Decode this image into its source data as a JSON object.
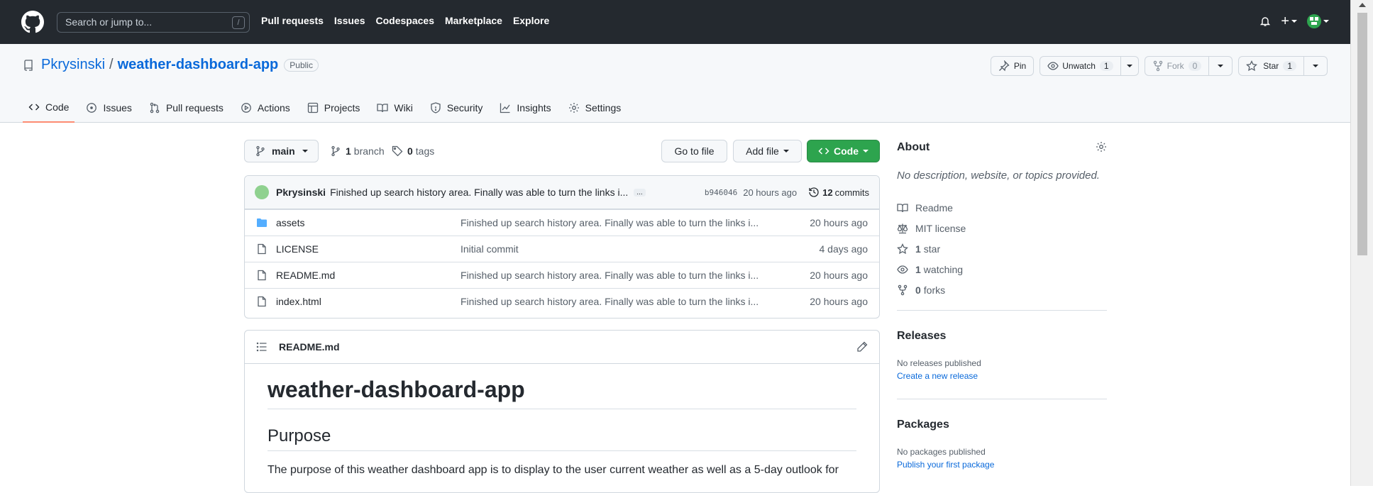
{
  "header": {
    "search_placeholder": "Search or jump to...",
    "search_shortcut": "/",
    "nav": [
      "Pull requests",
      "Issues",
      "Codespaces",
      "Marketplace",
      "Explore"
    ],
    "plus_label": "+"
  },
  "repo": {
    "owner": "Pkrysinski",
    "separator": "/",
    "name": "weather-dashboard-app",
    "visibility": "Public",
    "pin_label": "Pin",
    "unwatch_label": "Unwatch",
    "unwatch_count": "1",
    "fork_label": "Fork",
    "fork_count": "0",
    "star_label": "Star",
    "star_count": "1"
  },
  "tabs": [
    "Code",
    "Issues",
    "Pull requests",
    "Actions",
    "Projects",
    "Wiki",
    "Security",
    "Insights",
    "Settings"
  ],
  "toolbar": {
    "branch": "main",
    "branches_count": "1",
    "branches_label": "branch",
    "tags_count": "0",
    "tags_label": "tags",
    "go_to_file": "Go to file",
    "add_file": "Add file",
    "code": "Code"
  },
  "commit": {
    "author": "Pkrysinski",
    "message": "Finished up search history area. Finally was able to turn the links i...",
    "ellipsis": "...",
    "sha": "b946046",
    "age": "20 hours ago",
    "commits_count": "12",
    "commits_label": "commits"
  },
  "files": [
    {
      "name": "assets",
      "type": "folder",
      "message": "Finished up search history area. Finally was able to turn the links i...",
      "age": "20 hours ago"
    },
    {
      "name": "LICENSE",
      "type": "file",
      "message": "Initial commit",
      "age": "4 days ago"
    },
    {
      "name": "README.md",
      "type": "file",
      "message": "Finished up search history area. Finally was able to turn the links i...",
      "age": "20 hours ago"
    },
    {
      "name": "index.html",
      "type": "file",
      "message": "Finished up search history area. Finally was able to turn the links i...",
      "age": "20 hours ago"
    }
  ],
  "readme": {
    "filename": "README.md",
    "h1": "weather-dashboard-app",
    "h2": "Purpose",
    "paragraph": "The purpose of this weather dashboard app is to display to the user current weather as well as a 5-day outlook for"
  },
  "about": {
    "title": "About",
    "description": "No description, website, or topics provided.",
    "readme": "Readme",
    "license": "MIT license",
    "stars_count": "1",
    "stars_label": "star",
    "watching_count": "1",
    "watching_label": "watching",
    "forks_count": "0",
    "forks_label": "forks"
  },
  "releases": {
    "title": "Releases",
    "note": "No releases published",
    "link": "Create a new release"
  },
  "packages": {
    "title": "Packages",
    "note": "No packages published",
    "link": "Publish your first package"
  },
  "colors": {
    "header_bg": "#24292f",
    "link": "#0969da",
    "code_button": "#2da44e",
    "active_tab_underline": "#fd8c73"
  }
}
